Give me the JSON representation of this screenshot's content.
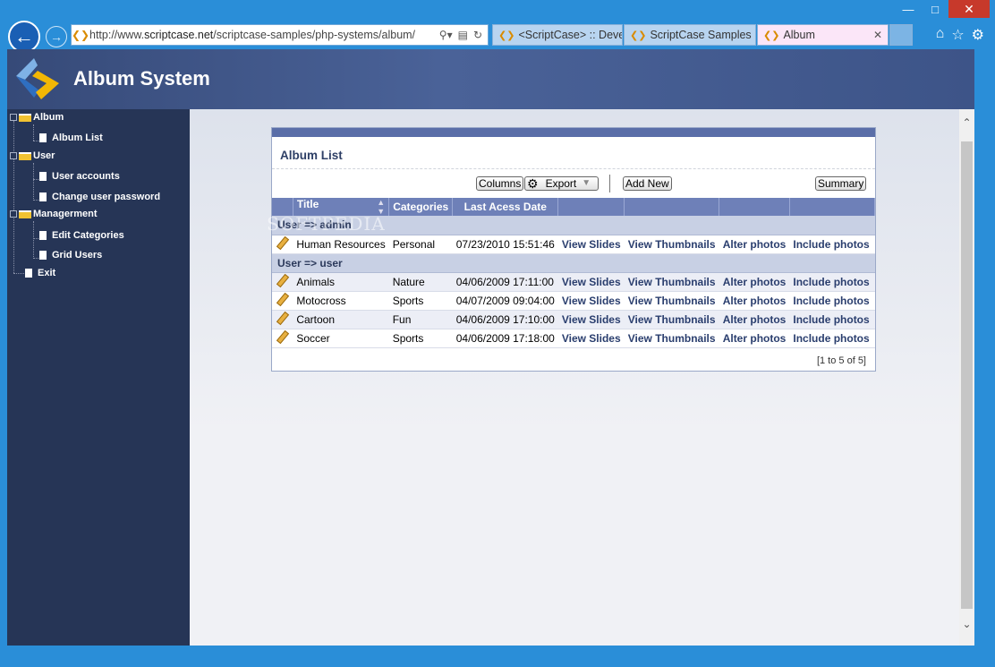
{
  "browser": {
    "url_prefix": "http://www.",
    "url_domain": "scriptcase.net",
    "url_path": "/scriptcase-samples/php-systems/album/",
    "tabs": [
      {
        "label": "<ScriptCase> :: Deve..."
      },
      {
        "label": "ScriptCase Samples | ..."
      },
      {
        "label": "Album"
      }
    ]
  },
  "app": {
    "title": "Album System"
  },
  "sidebar": {
    "items": [
      {
        "label": "Album"
      },
      {
        "label": "Album List"
      },
      {
        "label": "User"
      },
      {
        "label": "User accounts"
      },
      {
        "label": "Change user password"
      },
      {
        "label": "Managerment"
      },
      {
        "label": "Edit Categories"
      },
      {
        "label": "Grid Users"
      },
      {
        "label": "Exit"
      }
    ]
  },
  "panel": {
    "title": "Album List",
    "columns_button": "Columns",
    "export_button": "Export",
    "add_new_button": "Add New",
    "summary_button": "Summary",
    "headers": {
      "title": "Title",
      "categories": "Categories",
      "last_access": "Last Acess Date"
    },
    "groups": [
      {
        "label": "User => admin",
        "rows": [
          {
            "title": "Human Resources",
            "category": "Personal",
            "date": "07/23/2010 15:51:46"
          }
        ]
      },
      {
        "label": "User => user",
        "rows": [
          {
            "title": "Animals",
            "category": "Nature",
            "date": "04/06/2009 17:11:00"
          },
          {
            "title": "Motocross",
            "category": "Sports",
            "date": "04/07/2009 09:04:00"
          },
          {
            "title": "Cartoon",
            "category": "Fun",
            "date": "04/06/2009 17:10:00"
          },
          {
            "title": "Soccer",
            "category": "Sports",
            "date": "04/06/2009 17:18:00"
          }
        ]
      }
    ],
    "actions": {
      "view_slides": "View Slides",
      "view_thumbnails": "View Thumbnails",
      "alter_photos": "Alter photos",
      "include_photos": "Include photos"
    },
    "pager": "[1 to 5 of 5]"
  },
  "watermark": "SOFTPEDIA"
}
